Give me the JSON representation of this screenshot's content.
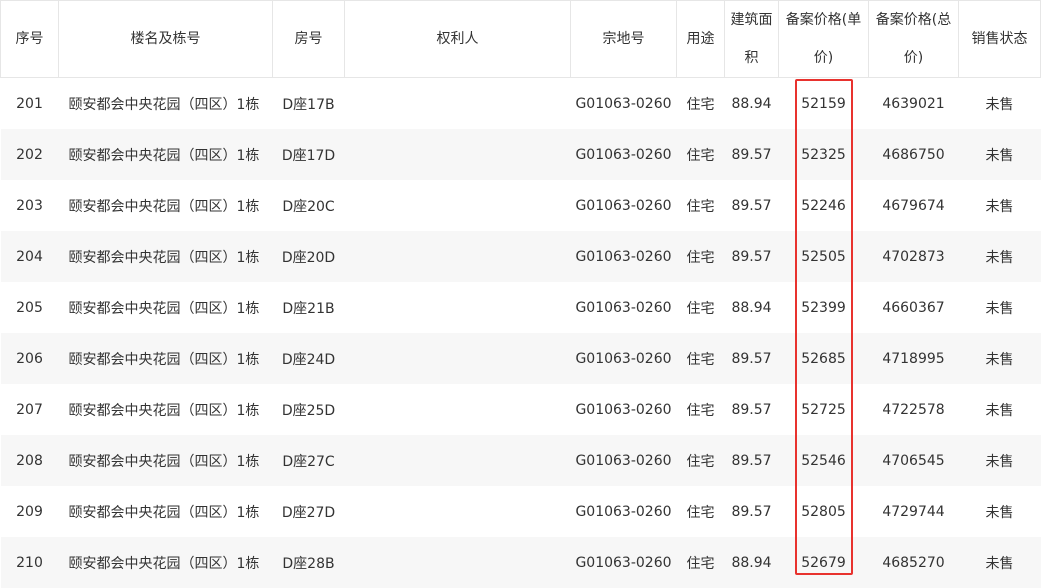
{
  "accent_color": "#e8322e",
  "headers": [
    "序号",
    "楼名及栋号",
    "房号",
    "权利人",
    "宗地号",
    "用途",
    "建筑面积",
    "备案价格(单价)",
    "备案价格(总价)",
    "销售状态"
  ],
  "rows": [
    [
      "201",
      "颐安都会中央花园（四区）1栋",
      "D座17B",
      "",
      "G01063-0260",
      "住宅",
      "88.94",
      "52159",
      "4639021",
      "未售"
    ],
    [
      "202",
      "颐安都会中央花园（四区）1栋",
      "D座17D",
      "",
      "G01063-0260",
      "住宅",
      "89.57",
      "52325",
      "4686750",
      "未售"
    ],
    [
      "203",
      "颐安都会中央花园（四区）1栋",
      "D座20C",
      "",
      "G01063-0260",
      "住宅",
      "89.57",
      "52246",
      "4679674",
      "未售"
    ],
    [
      "204",
      "颐安都会中央花园（四区）1栋",
      "D座20D",
      "",
      "G01063-0260",
      "住宅",
      "89.57",
      "52505",
      "4702873",
      "未售"
    ],
    [
      "205",
      "颐安都会中央花园（四区）1栋",
      "D座21B",
      "",
      "G01063-0260",
      "住宅",
      "88.94",
      "52399",
      "4660367",
      "未售"
    ],
    [
      "206",
      "颐安都会中央花园（四区）1栋",
      "D座24D",
      "",
      "G01063-0260",
      "住宅",
      "89.57",
      "52685",
      "4718995",
      "未售"
    ],
    [
      "207",
      "颐安都会中央花园（四区）1栋",
      "D座25D",
      "",
      "G01063-0260",
      "住宅",
      "89.57",
      "52725",
      "4722578",
      "未售"
    ],
    [
      "208",
      "颐安都会中央花园（四区）1栋",
      "D座27C",
      "",
      "G01063-0260",
      "住宅",
      "89.57",
      "52546",
      "4706545",
      "未售"
    ],
    [
      "209",
      "颐安都会中央花园（四区）1栋",
      "D座27D",
      "",
      "G01063-0260",
      "住宅",
      "89.57",
      "52805",
      "4729744",
      "未售"
    ],
    [
      "210",
      "颐安都会中央花园（四区）1栋",
      "D座28B",
      "",
      "G01063-0260",
      "住宅",
      "88.94",
      "52679",
      "4685270",
      "未售"
    ]
  ]
}
